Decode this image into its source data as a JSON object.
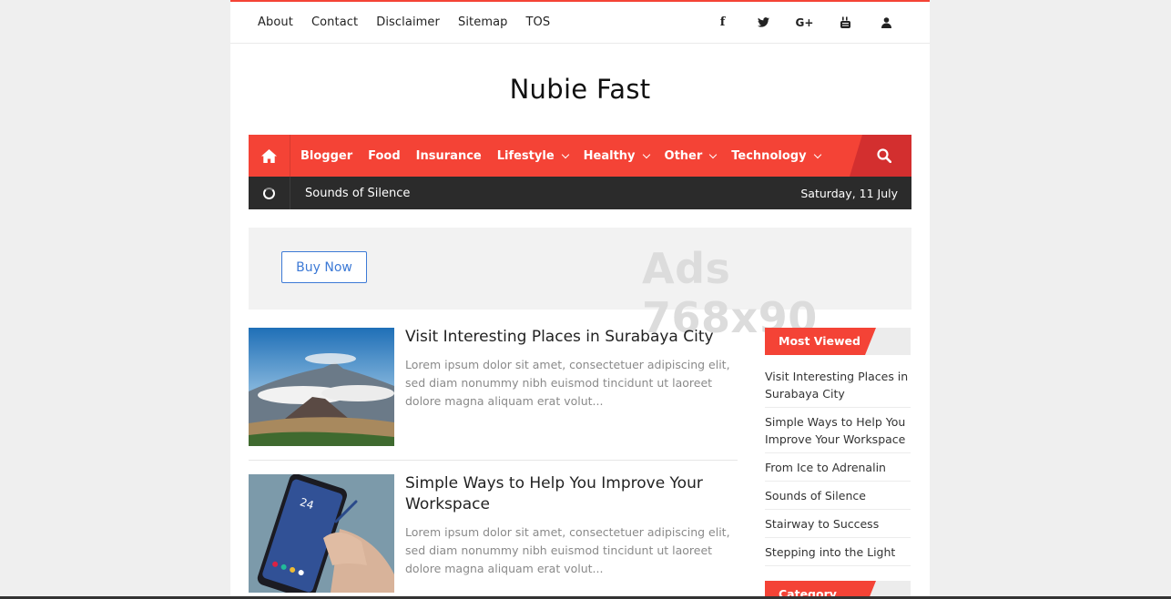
{
  "topbar": {
    "links": [
      "About",
      "Contact",
      "Disclaimer",
      "Sitemap",
      "TOS"
    ],
    "social_icons": [
      "facebook-icon",
      "twitter-icon",
      "google-plus-icon",
      "youtube-icon",
      "user-icon"
    ],
    "social_glyphs": [
      "f",
      "",
      "G+",
      "",
      ""
    ]
  },
  "header": {
    "title": "Nubie Fast"
  },
  "nav": {
    "items": [
      {
        "label": "Blogger"
      },
      {
        "label": "Food"
      },
      {
        "label": "Insurance"
      },
      {
        "label": "Lifestyle"
      },
      {
        "label": "Healthy"
      },
      {
        "label": "Other"
      },
      {
        "label": "Technology"
      }
    ]
  },
  "ticker": {
    "headline": "Sounds of Silence",
    "date": "Saturday, 11 July"
  },
  "ad": {
    "button_label": "Buy Now",
    "placeholder": "Ads 768x90"
  },
  "posts": [
    {
      "title": "Visit Interesting Places in Surabaya City",
      "excerpt": "Lorem ipsum dolor sit amet, consectetuer adipiscing elit, sed diam nonummy nibh euismod tincidunt ut laoreet dolore magna aliquam erat volut..."
    },
    {
      "title": "Simple Ways to Help You Improve Your Workspace",
      "excerpt": "Lorem ipsum dolor sit amet, consectetuer adipiscing elit, sed diam nonummy nibh euismod tincidunt ut laoreet dolore magna aliquam erat volut..."
    }
  ],
  "sidebar": {
    "most_viewed_title": "Most Viewed",
    "most_viewed": [
      "Visit Interesting Places in Surabaya City",
      "Simple Ways to Help You Improve Your Workspace",
      "From Ice to Adrenalin",
      "Sounds of Silence",
      "Stairway to Success",
      "Stepping into the Light"
    ],
    "category_title": "Category"
  },
  "colors": {
    "accent": "#f44336",
    "ticker_bg": "#2b2b2b",
    "button_blue": "#3d7ad6"
  }
}
